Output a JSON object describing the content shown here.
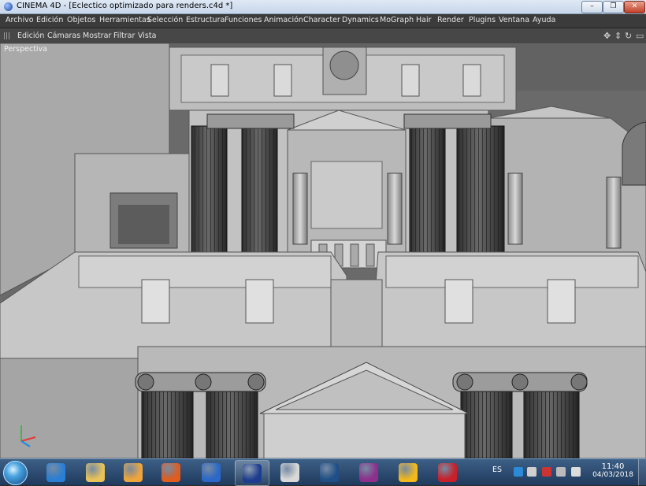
{
  "window": {
    "title": "CINEMA 4D - [Eclectico optimizado para renders.c4d *]",
    "minimize_glyph": "–",
    "maximize_glyph": "❐",
    "close_glyph": "✕"
  },
  "menubar": {
    "items": [
      "Archivo",
      "Edición",
      "Objetos",
      "Herramientas",
      "Selección",
      "Estructura",
      "Funciones",
      "Animación",
      "Character",
      "Dynamics",
      "MoGraph",
      "Hair",
      "Render",
      "Plugins",
      "Ventana",
      "Ayuda"
    ]
  },
  "viewport_menu": {
    "items": [
      "Edición",
      "Cámaras",
      "Mostrar",
      "Filtrar",
      "Vista"
    ],
    "nav_icons": [
      "move-view-icon",
      "zoom-view-icon",
      "rotate-view-icon",
      "toggle-view-icon"
    ]
  },
  "viewport": {
    "camera_label": "Perspectiva",
    "background_color": "#6a6a6a",
    "model_color": "#c4c4c4"
  },
  "taskbar": {
    "start_icon": "windows-start-orb-icon",
    "apps": [
      {
        "name": "internet-explorer-icon",
        "color": "#2a7fd4"
      },
      {
        "name": "file-explorer-icon",
        "color": "#e8c35a"
      },
      {
        "name": "media-player-icon",
        "color": "#f0a53c"
      },
      {
        "name": "firefox-icon",
        "color": "#e05c1f"
      },
      {
        "name": "kmplayer-icon",
        "color": "#2b68c7"
      },
      {
        "name": "cinema4d-icon",
        "color": "#1d3c8f"
      },
      {
        "name": "cinema4d-alt-icon",
        "color": "#d8d8d8"
      },
      {
        "name": "revit-icon",
        "color": "#1f4f86"
      },
      {
        "name": "rhino-render-icon",
        "color": "#8e2f8c"
      },
      {
        "name": "puzzle-app-icon",
        "color": "#f2b81c"
      },
      {
        "name": "autocad-icon",
        "color": "#c7202a"
      }
    ],
    "language": "ES",
    "tray_icons": [
      {
        "name": "edge-tray-icon",
        "color": "#2b8bd8"
      },
      {
        "name": "network-tray-icon",
        "color": "#cfcfcf"
      },
      {
        "name": "flag-tray-icon",
        "color": "#cc3333"
      },
      {
        "name": "battery-tray-icon",
        "color": "#bbbbbb"
      },
      {
        "name": "volume-tray-icon",
        "color": "#dddddd"
      }
    ],
    "time": "11:40",
    "date": "04/03/2018"
  }
}
